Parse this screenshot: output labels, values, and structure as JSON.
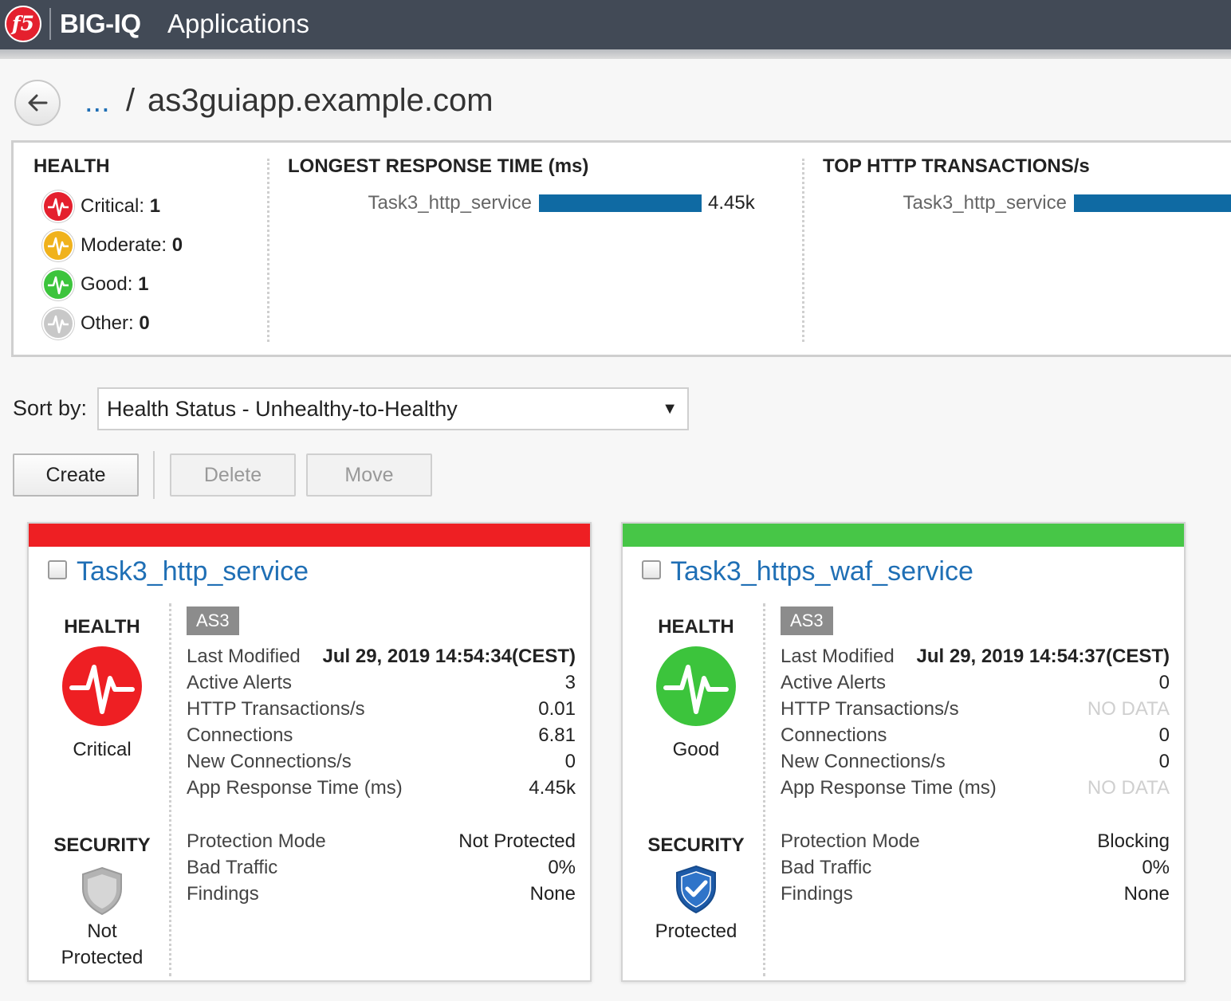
{
  "header": {
    "logo_text": "f5",
    "brand": "BIG-IQ",
    "section": "Applications"
  },
  "breadcrumb": {
    "ellipsis": "...",
    "separator": "/",
    "title": "as3guiapp.example.com"
  },
  "summary": {
    "health": {
      "heading": "HEALTH",
      "items": [
        {
          "label": "Critical:",
          "count": "1",
          "color": "#e4202e"
        },
        {
          "label": "Moderate:",
          "count": "0",
          "color": "#f0b21c"
        },
        {
          "label": "Good:",
          "count": "1",
          "color": "#3cc43c"
        },
        {
          "label": "Other:",
          "count": "0",
          "color": "#c8c8c8"
        }
      ]
    },
    "response_time": {
      "heading": "LONGEST RESPONSE TIME (ms)",
      "bar_label": "Task3_http_service",
      "bar_value": "4.45k"
    },
    "transactions": {
      "heading": "TOP HTTP TRANSACTIONS/s",
      "bar_label": "Task3_http_service"
    },
    "bar_color": "#0f6aa3"
  },
  "sort": {
    "label": "Sort by:",
    "value": "Health Status - Unhealthy-to-Healthy",
    "arrow": "▼"
  },
  "toolbar": {
    "create": "Create",
    "delete": "Delete",
    "move": "Move"
  },
  "cards": [
    {
      "name": "Task3_http_service",
      "stripe_color": "#ee1f23",
      "health_heading": "HEALTH",
      "health_status": "Critical",
      "health_color": "#ee1f23",
      "tag": "AS3",
      "metrics": [
        {
          "label": "Last Modified",
          "value": "Jul 29, 2019 14:54:34(CEST)"
        },
        {
          "label": "Active Alerts",
          "value": "3"
        },
        {
          "label": "HTTP Transactions/s",
          "value": "0.01"
        },
        {
          "label": "Connections",
          "value": "6.81"
        },
        {
          "label": "New Connections/s",
          "value": "0"
        },
        {
          "label": "App Response Time (ms)",
          "value": "4.45k"
        }
      ],
      "security_heading": "SECURITY",
      "security_status_line1": "Not",
      "security_status_line2": "Protected",
      "security": [
        {
          "label": "Protection Mode",
          "value": "Not Protected"
        },
        {
          "label": "Bad Traffic",
          "value": "0%"
        },
        {
          "label": "Findings",
          "value": "None"
        }
      ]
    },
    {
      "name": "Task3_https_waf_service",
      "stripe_color": "#47c647",
      "health_heading": "HEALTH",
      "health_status": "Good",
      "health_color": "#3cc43c",
      "tag": "AS3",
      "metrics": [
        {
          "label": "Last Modified",
          "value": "Jul 29, 2019 14:54:37(CEST)"
        },
        {
          "label": "Active Alerts",
          "value": "0"
        },
        {
          "label": "HTTP Transactions/s",
          "value": "NO DATA"
        },
        {
          "label": "Connections",
          "value": "0"
        },
        {
          "label": "New Connections/s",
          "value": "0"
        },
        {
          "label": "App Response Time (ms)",
          "value": "NO DATA"
        }
      ],
      "security_heading": "SECURITY",
      "security_status_line1": "Protected",
      "security": [
        {
          "label": "Protection Mode",
          "value": "Blocking"
        },
        {
          "label": "Bad Traffic",
          "value": "0%"
        },
        {
          "label": "Findings",
          "value": "None"
        }
      ]
    }
  ]
}
